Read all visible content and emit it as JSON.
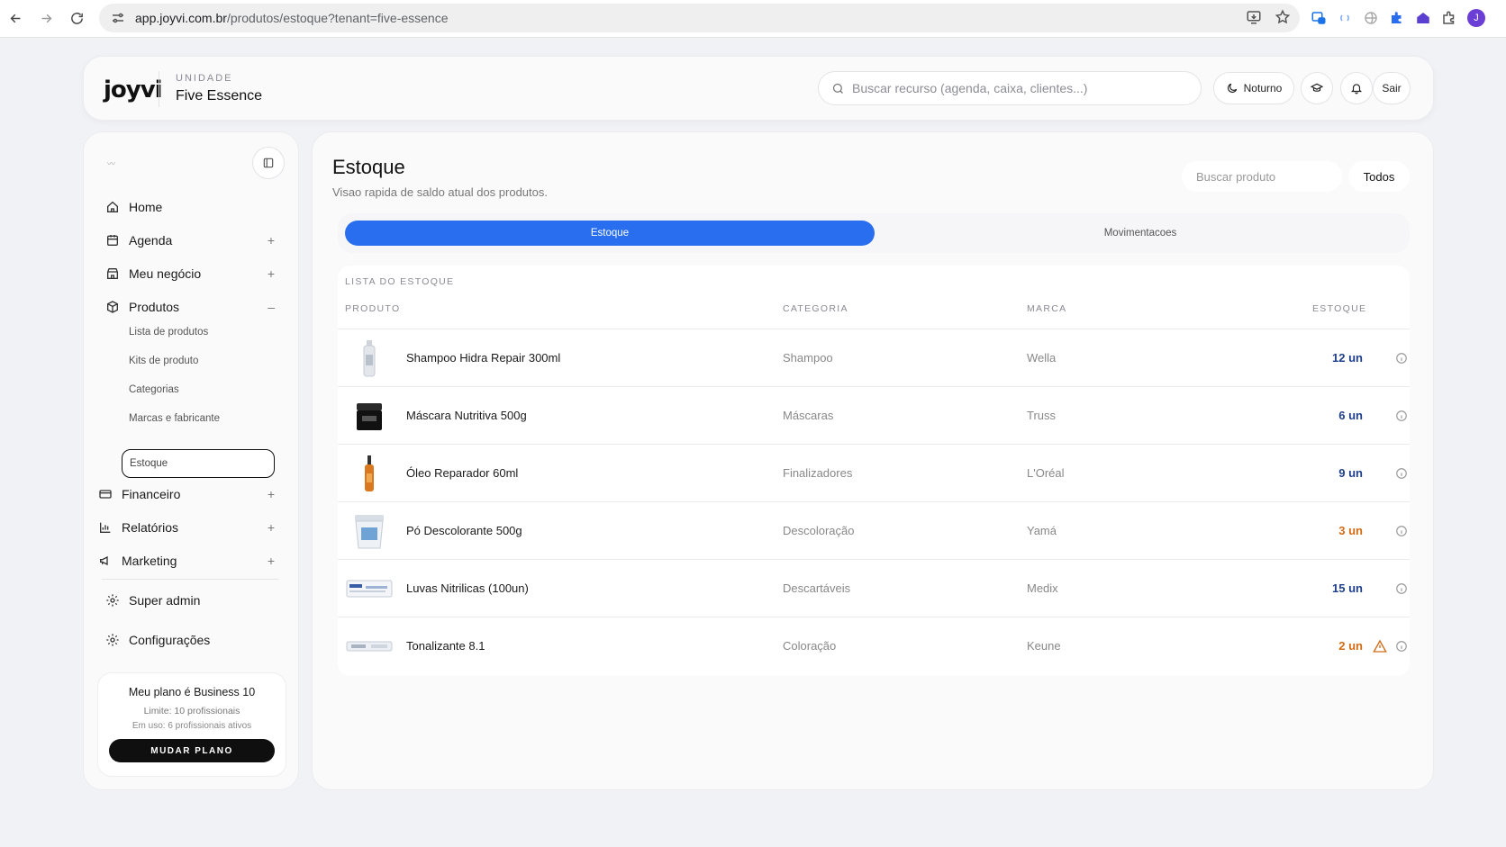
{
  "browser": {
    "url_domain": "app.joyvi.com.br",
    "url_path": "/produtos/estoque?tenant=five-essence",
    "profile_initial": "J"
  },
  "header": {
    "logo": "joyvi",
    "unit_label": "UNIDADE",
    "unit_name": "Five Essence",
    "search_placeholder": "Buscar recurso (agenda, caixa, clientes...)",
    "night_label": "Noturno",
    "logout_label": "Sair"
  },
  "sidebar": {
    "items": [
      {
        "label": "Home",
        "icon": "home-icon",
        "toggle": ""
      },
      {
        "label": "Agenda",
        "icon": "calendar-icon",
        "toggle": "+"
      },
      {
        "label": "Meu negócio",
        "icon": "store-icon",
        "toggle": "+"
      },
      {
        "label": "Produtos",
        "icon": "box-icon",
        "toggle": "–"
      }
    ],
    "subitems": [
      "Lista de produtos",
      "Kits de produto",
      "Categorias",
      "Marcas e fabricante"
    ],
    "active_subitem": "Estoque",
    "items_after": [
      {
        "label": "Financeiro",
        "icon": "card-icon",
        "toggle": "+"
      },
      {
        "label": "Relatórios",
        "icon": "chart-icon",
        "toggle": "+"
      },
      {
        "label": "Marketing",
        "icon": "megaphone-icon",
        "toggle": "+"
      }
    ],
    "bottom_items": [
      {
        "label": "Super admin",
        "icon": "gear-icon"
      },
      {
        "label": "Configurações",
        "icon": "gear-icon"
      }
    ],
    "plan": {
      "title": "Meu plano é Business 10",
      "limit": "Limite: 10 profissionais",
      "in_use": "Em uso: 6 profissionais ativos",
      "button": "MUDAR PLANO"
    }
  },
  "main": {
    "title": "Estoque",
    "subtitle": "Visao rapida de saldo atual dos produtos.",
    "search_placeholder": "Buscar produto",
    "filter": "Todos",
    "tabs": [
      "Estoque",
      "Movimentacoes"
    ],
    "list_label": "LISTA DO ESTOQUE",
    "columns": [
      "PRODUTO",
      "CATEGORIA",
      "MARCA",
      "ESTOQUE"
    ],
    "rows": [
      {
        "name": "Shampoo Hidra Repair 300ml",
        "category": "Shampoo",
        "brand": "Wella",
        "qty": "12 un",
        "low": false,
        "thumb": "bottle"
      },
      {
        "name": "Máscara Nutritiva 500g",
        "category": "Máscaras",
        "brand": "Truss",
        "qty": "6 un",
        "low": false,
        "thumb": "jar"
      },
      {
        "name": "Óleo Reparador 60ml",
        "category": "Finalizadores",
        "brand": "L'Oréal",
        "qty": "9 un",
        "low": false,
        "thumb": "oil"
      },
      {
        "name": "Pó Descolorante 500g",
        "category": "Descoloração",
        "brand": "Yamá",
        "qty": "3 un",
        "low": true,
        "thumb": "tub"
      },
      {
        "name": "Luvas Nitrilicas (100un)",
        "category": "Descartáveis",
        "brand": "Medix",
        "qty": "15 un",
        "low": false,
        "thumb": "box"
      },
      {
        "name": "Tonalizante 8.1",
        "category": "Coloração",
        "brand": "Keune",
        "qty": "2 un",
        "low": true,
        "thumb": "tube"
      }
    ]
  },
  "colors": {
    "accent": "#2a6ef0",
    "low_stock": "#d36b15",
    "ok_stock": "#1f3f8a"
  }
}
